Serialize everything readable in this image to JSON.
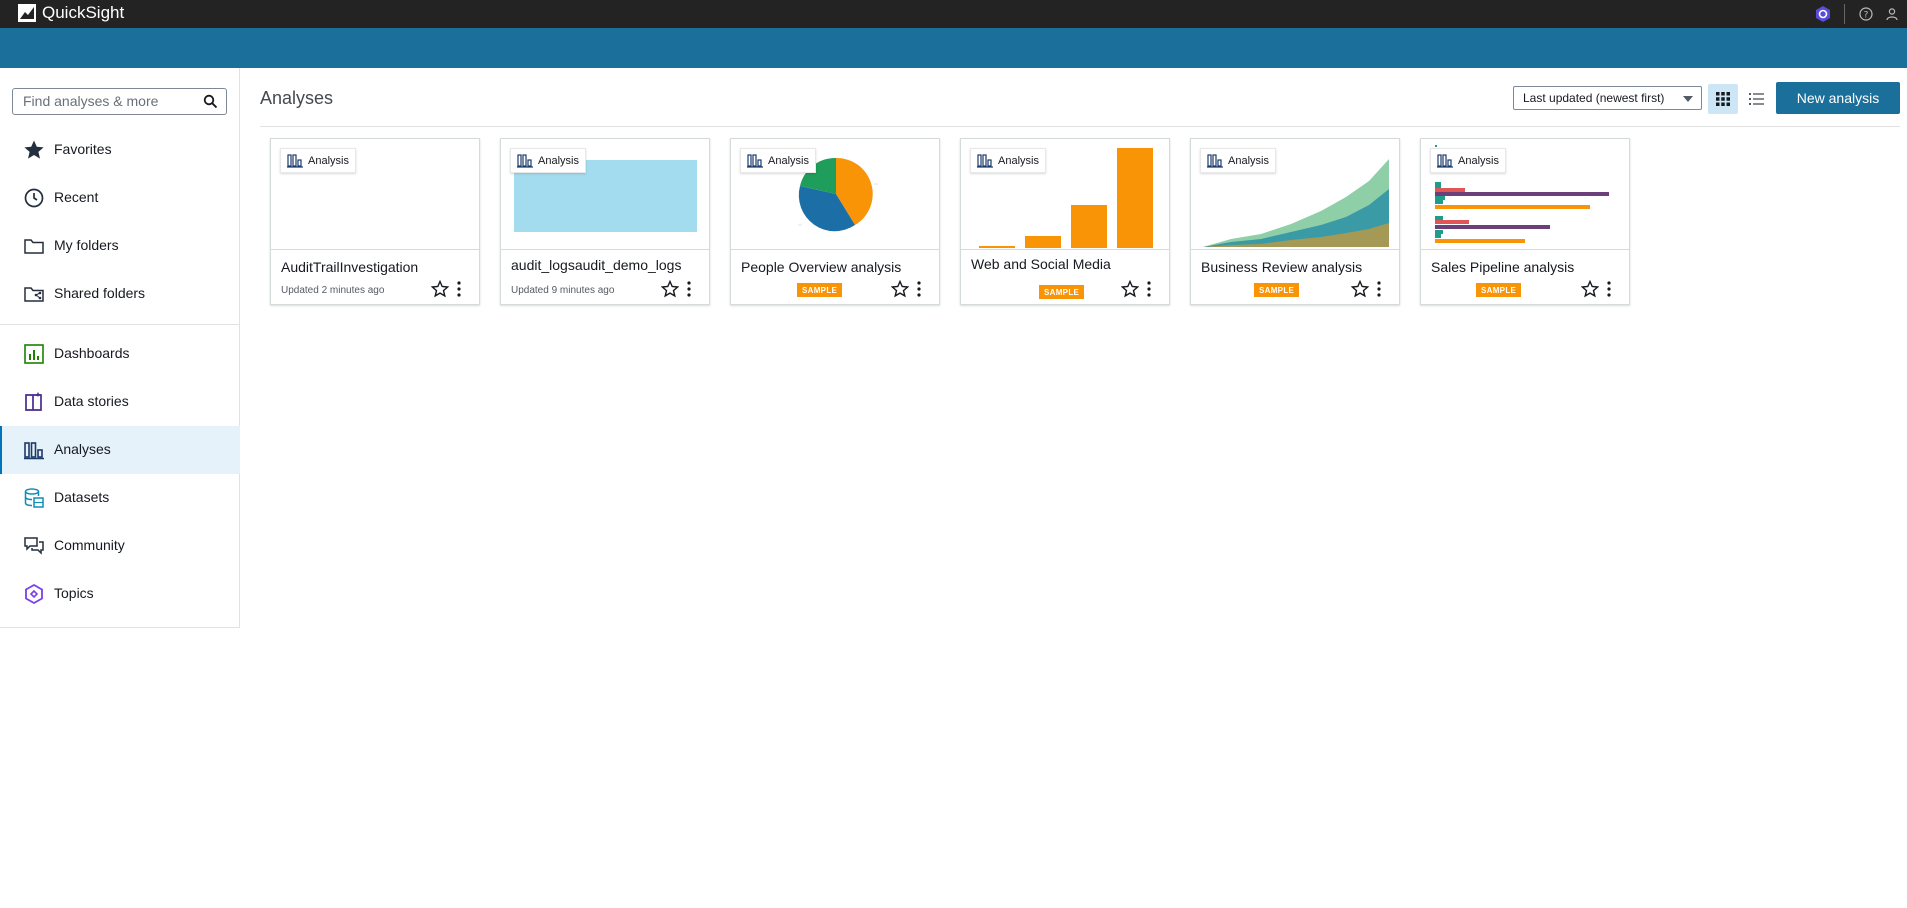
{
  "app": {
    "name": "QuickSight"
  },
  "search": {
    "placeholder": "Find analyses & more"
  },
  "sidebar": {
    "top_items": [
      {
        "label": "Favorites",
        "icon": "star-filled-icon"
      },
      {
        "label": "Recent",
        "icon": "clock-icon"
      },
      {
        "label": "My folders",
        "icon": "folder-icon"
      },
      {
        "label": "Shared folders",
        "icon": "shared-folder-icon"
      }
    ],
    "bottom_items": [
      {
        "label": "Dashboards",
        "icon": "dashboard-icon"
      },
      {
        "label": "Data stories",
        "icon": "data-stories-icon"
      },
      {
        "label": "Analyses",
        "icon": "analyses-icon",
        "active": true
      },
      {
        "label": "Datasets",
        "icon": "datasets-icon"
      },
      {
        "label": "Community",
        "icon": "community-icon"
      },
      {
        "label": "Topics",
        "icon": "topics-icon"
      }
    ]
  },
  "main": {
    "title": "Analyses",
    "sort_label": "Last updated (newest first)",
    "new_button": "New analysis"
  },
  "cards": [
    {
      "name": "AuditTrailInvestigation",
      "subtitle": "Updated 2 minutes ago",
      "badge": "Analysis",
      "thumb": "blank"
    },
    {
      "name": "audit_logsaudit_demo_logs",
      "subtitle": "Updated 9 minutes ago",
      "badge": "Analysis",
      "thumb": "lightblue"
    },
    {
      "name": "People Overview analysis",
      "tag": "SAMPLE",
      "badge": "Analysis",
      "thumb": "pie"
    },
    {
      "name": "Web and Social Media",
      "tag": "SAMPLE",
      "badge": "Analysis",
      "thumb": "bars"
    },
    {
      "name": "Business Review analysis",
      "tag": "SAMPLE",
      "badge": "Analysis",
      "thumb": "area"
    },
    {
      "name": "Sales Pipeline analysis",
      "tag": "SAMPLE",
      "badge": "Analysis",
      "thumb": "hbars"
    }
  ],
  "colors": {
    "topbar": "#232323",
    "band": "#1b6f9b",
    "accent": "#1b6f9b",
    "active_bg": "#e6f2fa",
    "sample": "#f89406"
  }
}
